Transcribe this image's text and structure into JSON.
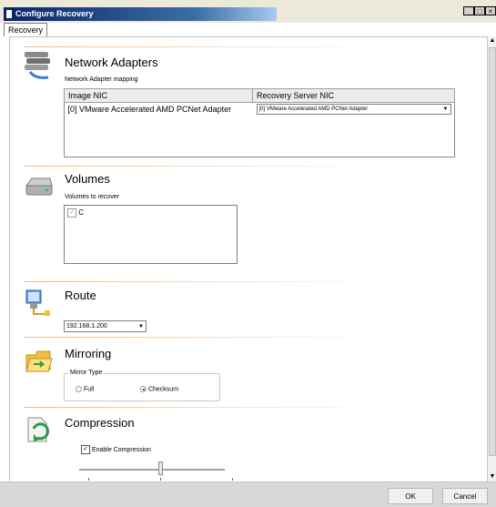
{
  "window": {
    "title": "Configure Recovery",
    "min_label": "_",
    "max_label": "□",
    "close_label": "×"
  },
  "tab": {
    "label": "Recovery"
  },
  "network": {
    "heading": "Network Adapters",
    "mapping_label": "Network Adapter mapping",
    "columns": [
      "Image NIC",
      "Recovery Server NIC"
    ],
    "rows": [
      {
        "image_nic": "[0] VMware Accelerated AMD PCNet Adapter",
        "recovery_nic": "[0] VMware Accelerated AMD PCNet Adapter"
      }
    ]
  },
  "volumes": {
    "heading": "Volumes",
    "label": "Volumes to recover",
    "items": [
      {
        "name": "C",
        "checked": true
      }
    ]
  },
  "route": {
    "heading": "Route",
    "selected": "192.168.1.200"
  },
  "mirroring": {
    "heading": "Mirroring",
    "group_label": "Mirror Type",
    "options": [
      "Full",
      "Checksum"
    ],
    "selected": "Checksum"
  },
  "compression": {
    "heading": "Compression",
    "checkbox_label": "Enable Compression",
    "enabled": true,
    "level_fraction": 0.5
  },
  "footer": {
    "ok_label": "OK",
    "cancel_label": "Cancel"
  },
  "colors": {
    "title_bar": "#0a246a",
    "separator": "#f5b780"
  }
}
